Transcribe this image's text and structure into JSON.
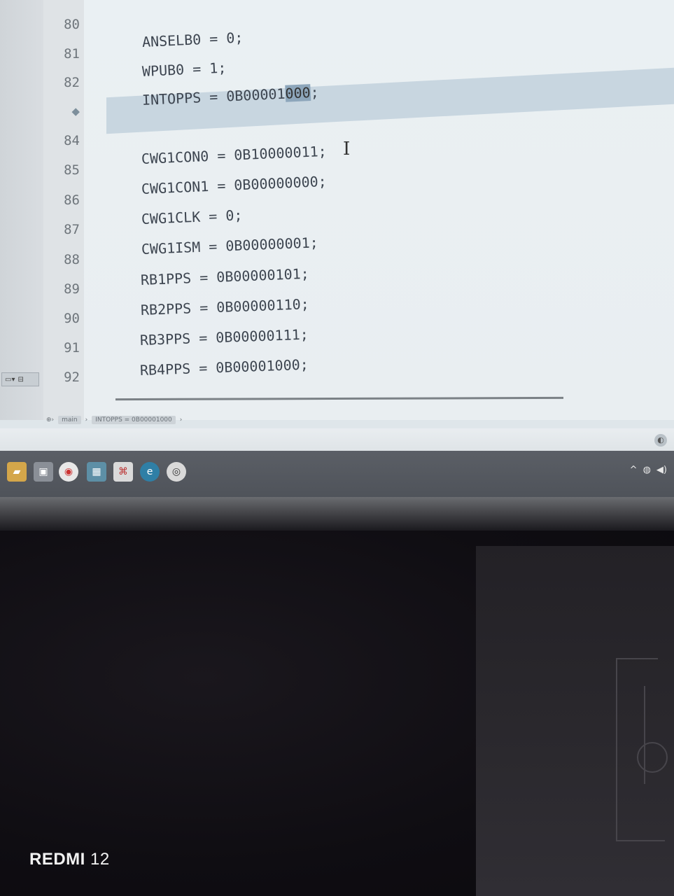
{
  "editor": {
    "line_numbers": [
      "80",
      "81",
      "82",
      "",
      "84",
      "85",
      "86",
      "87",
      "88",
      "89",
      "90",
      "91",
      "92"
    ],
    "lines": [
      "",
      "ANSELB0 = 0;",
      "WPUB0 = 1;",
      "INTOPPS = 0B00001000;",
      "",
      "CWG1CON0 = 0B10000011;",
      "CWG1CON1 = 0B00000000;",
      "CWG1CLK = 0;",
      "CWG1ISM = 0B00000001;",
      "RB1PPS = 0B00000101;",
      "RB2PPS = 0B00000110;",
      "RB3PPS = 0B00000111;",
      "RB4PPS = 0B00001000;"
    ],
    "intopps_prefix": "INTOPPS = 0B00001",
    "intopps_selected": "000",
    "intopps_suffix": ";",
    "cursor_glyph": "I"
  },
  "breadcrumb": {
    "items": [
      "main",
      "INTOPPS = 0B00001000"
    ]
  },
  "taskbar": {
    "icons": [
      "file-explorer-icon",
      "app-icon",
      "chrome-icon",
      "calculator-icon",
      "pdf-icon",
      "edge-icon",
      "mplab-icon"
    ],
    "tray": [
      "^",
      "network-icon",
      "volume-icon"
    ]
  },
  "watermark": {
    "brand": "REDMI",
    "model": "12"
  }
}
